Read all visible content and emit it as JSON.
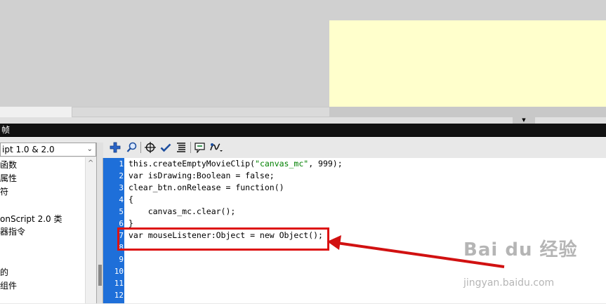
{
  "panel": {
    "title": "帧"
  },
  "actions_toolbox": {
    "language": "ipt 1.0 & 2.0",
    "items": [
      "函数",
      "属性",
      "符",
      "",
      "onScript 2.0 类",
      "器指令",
      "",
      "",
      "的",
      "组件"
    ]
  },
  "toolbar": {
    "icons": [
      "add-statement-icon",
      "find-icon",
      "target-icon",
      "check-syntax-icon",
      "auto-format-icon",
      "code-hint-icon",
      "debug-options-icon"
    ]
  },
  "editor": {
    "line_numbers": [
      "1",
      "2",
      "3",
      "4",
      "5",
      "6",
      "7",
      "8",
      "9",
      "10",
      "11",
      "12"
    ],
    "lines": [
      {
        "a": "this.createEmptyMovieClip(",
        "s": "\"canvas_mc\"",
        "b": ", 999);"
      },
      {
        "a": "var isDrawing:Boolean = false;",
        "s": "",
        "b": ""
      },
      {
        "a": "clear_btn.onRelease = function()",
        "s": "",
        "b": ""
      },
      {
        "a": "{",
        "s": "",
        "b": ""
      },
      {
        "a": "    canvas_mc.clear();",
        "s": "",
        "b": ""
      },
      {
        "a": "}",
        "s": "",
        "b": ""
      },
      {
        "a": "var mouseListener:Object = new Object();",
        "s": "",
        "b": ""
      }
    ]
  },
  "colors": {
    "highlight": "#d11111",
    "gutter": "#1e6fd9",
    "stage": "#ffffcc"
  },
  "watermark": {
    "main": "Bai du 经验",
    "sub": "jingyan.baidu.com"
  }
}
